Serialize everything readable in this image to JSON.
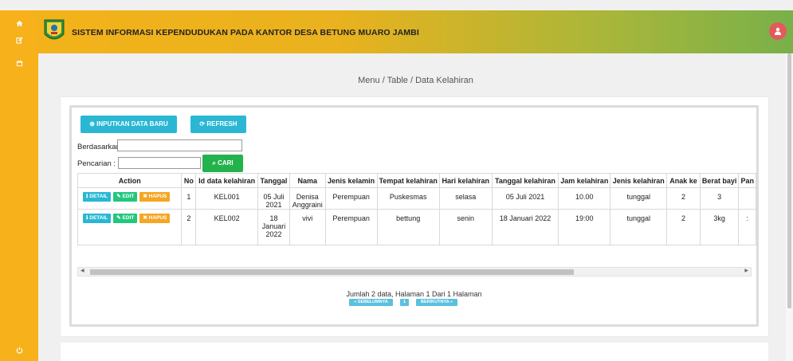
{
  "app": {
    "title": "SISTEM INFORMASI KEPENDUDUKAN PADA KANTOR DESA BETUNG MUARO JAMBI"
  },
  "breadcrumb": "Menu / Table / Data Kelahiran",
  "toolbar": {
    "new_label": "INPUTKAN DATA BARU",
    "refresh_label": "REFRESH",
    "cari_label": "CARI"
  },
  "search": {
    "berdasarkan_label": "Berdasarkan:",
    "pencarian_label": "Pencarian  :",
    "berdasarkan_value": "",
    "pencarian_value": ""
  },
  "sidebar": {
    "icons": [
      "home-icon",
      "edit-icon",
      "calendar-icon",
      "power-icon"
    ]
  },
  "table": {
    "headers": [
      "Action",
      "No",
      "Id data kelahiran",
      "Tanggal",
      "Nama",
      "Jenis kelamin",
      "Tempat kelahiran",
      "Hari kelahiran",
      "Tanggal kelahiran",
      "Jam kelahiran",
      "Jenis kelahiran",
      "Anak ke",
      "Berat bayi",
      "Pan"
    ],
    "action_labels": {
      "detail": "DETAIL",
      "edit": "EDIT",
      "hapus": "HAPUS"
    },
    "rows": [
      [
        "1",
        "KEL001",
        "05 Juli 2021",
        "Denisa Anggraini",
        "Perempuan",
        "Puskesmas",
        "selasa",
        "05 Juli 2021",
        "10.00",
        "tunggal",
        "2",
        "3",
        ""
      ],
      [
        "2",
        "KEL002",
        "18 Januari 2022",
        "vivi",
        "Perempuan",
        "bettung",
        "senin",
        "18 Januari 2022",
        "19:00",
        "tunggal",
        "2",
        "3kg",
        ":"
      ]
    ]
  },
  "pagination": {
    "summary": "Jumlah 2 data, Halaman 1 Dari 1 Halaman",
    "prev_label": "« SEBELUMNYA",
    "page": "1",
    "next_label": "BERIKUTNYA »"
  },
  "colors": {
    "sidebar": "#f7b11b",
    "info": "#2ab7d4",
    "success": "#23b24b",
    "warning": "#f5a623"
  }
}
